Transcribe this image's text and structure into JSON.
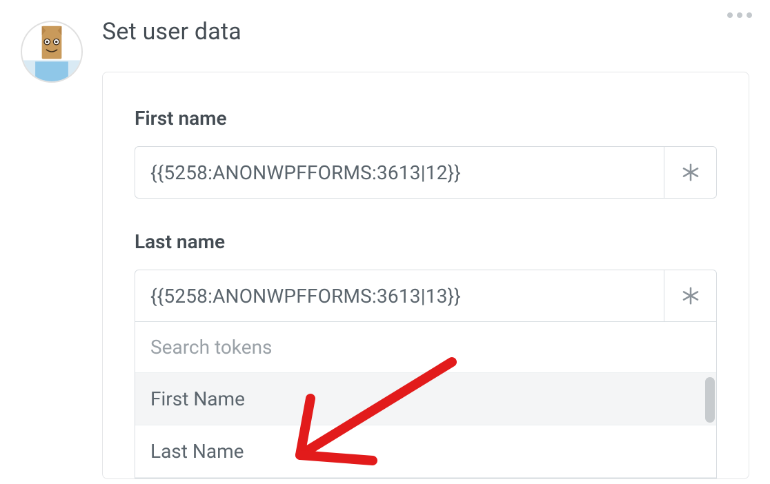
{
  "heading": "Set user data",
  "avatar": {
    "alt": "paper-bag-avatar"
  },
  "fields": {
    "first_name": {
      "label": "First name",
      "value": "{{5258:ANONWPFFORMS:3613|12}}"
    },
    "last_name": {
      "label": "Last name",
      "value": "{{5258:ANONWPFFORMS:3613|13}}"
    }
  },
  "token_dropdown": {
    "search_placeholder": "Search tokens",
    "items": [
      {
        "label": "First Name"
      },
      {
        "label": "Last Name"
      }
    ]
  }
}
